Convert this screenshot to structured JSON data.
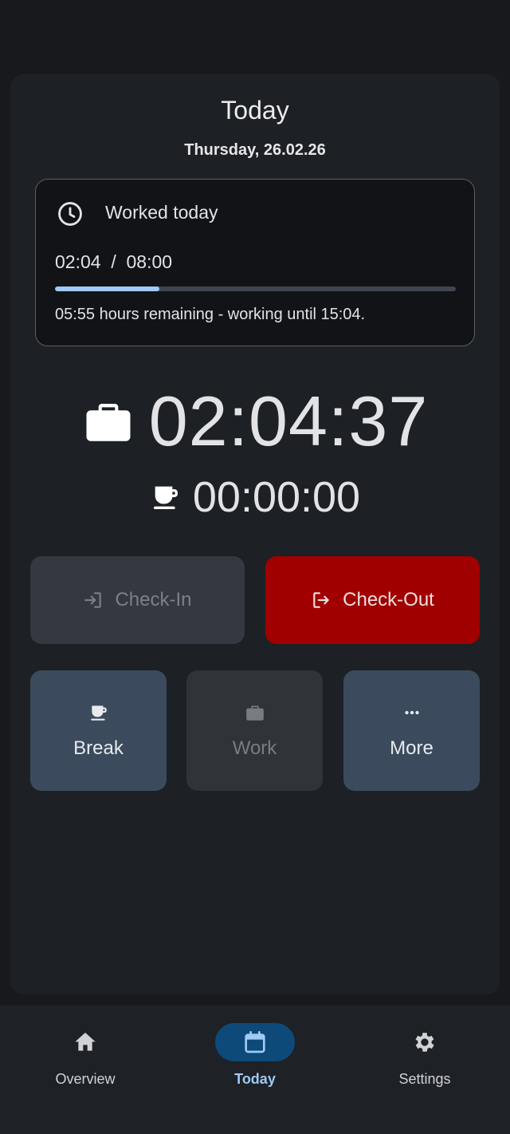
{
  "header": {
    "title": "Today",
    "date": "Thursday, 26.02.26"
  },
  "worked": {
    "label": "Worked today",
    "time": "02:04  /  08:00",
    "progress": 0.26,
    "remaining": "05:55 hours remaining - working until 15:04."
  },
  "timers": {
    "work": "02:04:37",
    "break": "00:00:00"
  },
  "actions": {
    "checkin_label": "Check-In",
    "checkout_label": "Check-Out"
  },
  "tiles": {
    "break_label": "Break",
    "work_label": "Work",
    "more_label": "More"
  },
  "nav": {
    "items": [
      {
        "label": "Overview",
        "icon": "home-icon"
      },
      {
        "label": "Today",
        "icon": "calendar-icon",
        "active": true
      },
      {
        "label": "Settings",
        "icon": "gear-icon"
      }
    ]
  },
  "colors": {
    "accent": "#9ecaf3",
    "checkout": "#a00000",
    "nav_active": "#0d4a7a"
  }
}
